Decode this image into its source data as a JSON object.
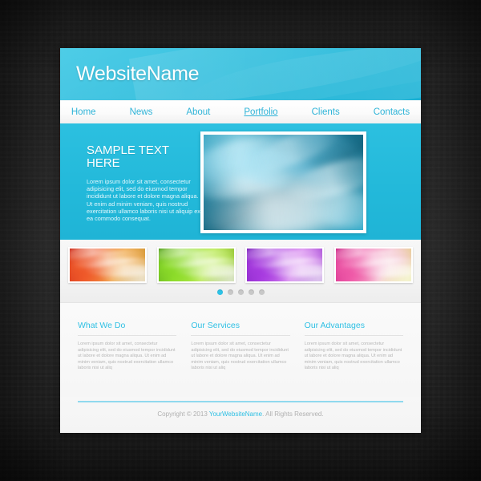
{
  "site": {
    "logo": "WebsiteName",
    "nav": [
      {
        "label": "Home",
        "active": false
      },
      {
        "label": "News",
        "active": false
      },
      {
        "label": "About",
        "active": false
      },
      {
        "label": "Portfolio",
        "active": true
      },
      {
        "label": "Clients",
        "active": false
      },
      {
        "label": "Contacts",
        "active": false
      }
    ],
    "hero": {
      "title_line1": "SAMPLE TEXT",
      "title_line2": "HERE",
      "body": "Lorem ipsum dolor sit amet, consectetur adipisicing elit, sed do eiusmod tempor incididunt ut labore et dolore magna aliqua. Ut enim ad minim veniam, quis nostrud exercitation ullamco laboris nisi ut aliquip ex ea commodo consequat.",
      "prev_icon": "chevron-left-icon",
      "next_icon": "chevron-right-icon",
      "image_alt": "blue-abstract-waves"
    },
    "thumbnails": [
      {
        "name": "red-orange-waves",
        "c1": "#c41b12",
        "c2": "#ef5a2a",
        "c3": "#f0a84a",
        "c4": "#b58b28"
      },
      {
        "name": "green-waves",
        "c1": "#3e8c12",
        "c2": "#8ddc2a",
        "c3": "#b9ea52",
        "c4": "#6f9a1e"
      },
      {
        "name": "purple-waves",
        "c1": "#6a12b0",
        "c2": "#a83ce0",
        "c3": "#d98cf0",
        "c4": "#7b1fbd"
      },
      {
        "name": "pink-yellow-waves",
        "c1": "#c0117a",
        "c2": "#ef5aa8",
        "c3": "#f6c8d6",
        "c4": "#d6d84a"
      }
    ],
    "pagination": {
      "count": 5,
      "active_index": 0,
      "active_color": "#2ec2e6",
      "inactive_color": "#c8c8c8"
    },
    "columns": [
      {
        "title": "What We Do",
        "body": "Lorem ipsum dolor sit amet, consectetur adipisicing elit, sed do eiusmod tempor incididunt ut labore et dolore magna aliqua. Ut enim ad minim veniam, quis nostrud exercitation ullamco laboris nisi ut aliq"
      },
      {
        "title": "Our Services",
        "body": "Lorem ipsum dolor sit amet, consectetur adipisicing elit, sed do eiusmod tempor incididunt ut labore et dolore magna aliqua. Ut enim ad minim veniam, quis nostrud exercitation ullamco laboris nisi ut aliq"
      },
      {
        "title": "Our Advantages",
        "body": "Lorem ipsum dolor sit amet, consectetur adipisicing elit, sed do eiusmod tempor incididunt ut labore et dolore magna aliqua. Ut enim ad minim veniam, quis nostrud exercitation ullamco laboris nisi ut aliq"
      }
    ],
    "footer": {
      "copyright_prefix": "Copyright © 2013 ",
      "brand": "YourWebsiteName",
      "copyright_suffix": ". All Rights Reserved."
    },
    "colors": {
      "accent": "#2fc0e4",
      "header_cyan": "#26bcdd",
      "page_background": "#262626",
      "panel": "#f4f4f4"
    }
  }
}
